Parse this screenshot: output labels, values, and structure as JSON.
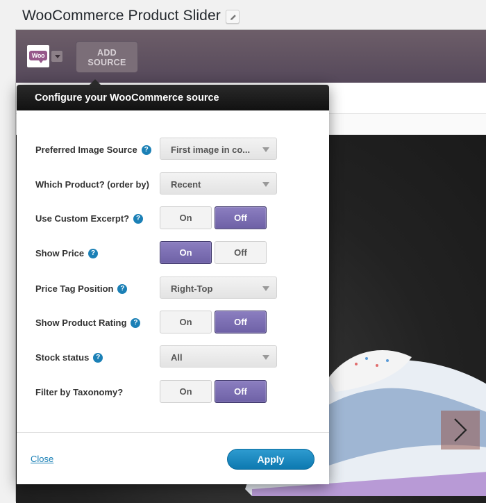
{
  "page": {
    "title": "WooCommerce Product Slider"
  },
  "toolbar": {
    "logo_text": "Woo",
    "add_source_line1": "ADD",
    "add_source_line2": "SOURCE"
  },
  "dialog": {
    "title": "Configure your WooCommerce source",
    "rows": [
      {
        "label": "Preferred Image Source",
        "help": true,
        "control": "select",
        "value": "First image in co..."
      },
      {
        "label": "Which Product? (order by)",
        "help": false,
        "control": "select",
        "value": "Recent"
      },
      {
        "label": "Use Custom Excerpt?",
        "help": true,
        "control": "toggle",
        "on_label": "On",
        "off_label": "Off",
        "selected": "Off"
      },
      {
        "label": "Show Price",
        "help": true,
        "control": "toggle",
        "on_label": "On",
        "off_label": "Off",
        "selected": "On"
      },
      {
        "label": "Price Tag Position",
        "help": true,
        "control": "select",
        "value": "Right-Top"
      },
      {
        "label": "Show Product Rating",
        "help": true,
        "control": "toggle",
        "on_label": "On",
        "off_label": "Off",
        "selected": "Off"
      },
      {
        "label": "Stock status",
        "help": true,
        "control": "select",
        "value": "All"
      },
      {
        "label": "Filter by Taxonomy?",
        "help": false,
        "control": "toggle",
        "on_label": "On",
        "off_label": "Off",
        "selected": "Off"
      }
    ],
    "help_glyph": "?",
    "close_label": "Close",
    "apply_label": "Apply"
  },
  "colors": {
    "toolbar": "#5e5160",
    "toggle_active": "#7a6db3",
    "primary": "#1b80b6"
  },
  "icons": [
    "edit-icon",
    "woo-logo-icon",
    "chevron-down-icon",
    "next-arrow-icon",
    "help-icon"
  ]
}
